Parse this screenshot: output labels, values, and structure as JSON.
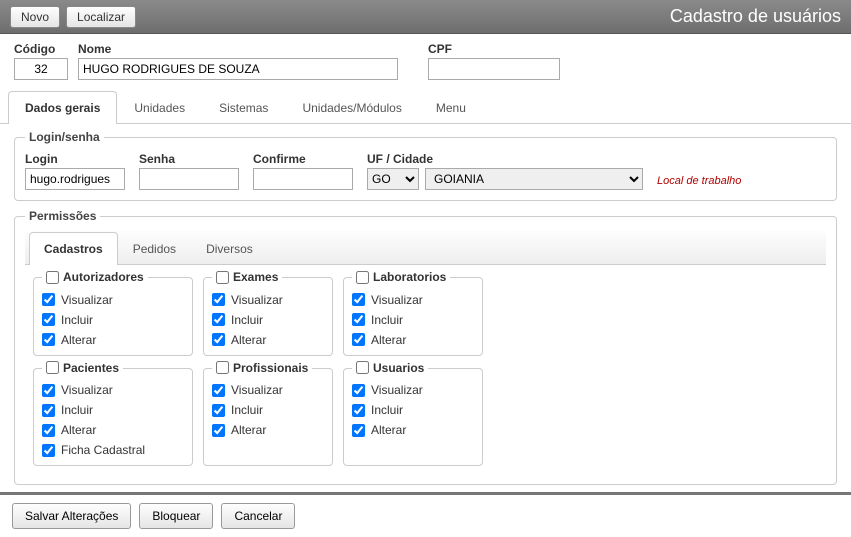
{
  "topbar": {
    "novo": "Novo",
    "localizar": "Localizar",
    "title": "Cadastro de usuários"
  },
  "header": {
    "codigo_label": "Código",
    "codigo_value": "32",
    "nome_label": "Nome",
    "nome_value": "HUGO RODRIGUES DE SOUZA",
    "cpf_label": "CPF",
    "cpf_value": ""
  },
  "main_tabs": {
    "dados": "Dados gerais",
    "unidades": "Unidades",
    "sistemas": "Sistemas",
    "unimod": "Unidades/Módulos",
    "menu": "Menu"
  },
  "login": {
    "legend": "Login/senha",
    "login_label": "Login",
    "login_value": "hugo.rodrigues",
    "senha_label": "Senha",
    "senha_value": "",
    "confirme_label": "Confirme",
    "confirme_value": "",
    "ufcidade_label": "UF / Cidade",
    "uf_value": "GO",
    "cidade_value": "GOIANIA",
    "hint": "Local de trabalho"
  },
  "permissoes": {
    "legend": "Permissões",
    "inner_tabs": {
      "cadastros": "Cadastros",
      "pedidos": "Pedidos",
      "diversos": "Diversos"
    },
    "groups": [
      {
        "name": "Autorizadores",
        "items": [
          {
            "label": "Visualizar",
            "checked": true
          },
          {
            "label": "Incluir",
            "checked": true
          },
          {
            "label": "Alterar",
            "checked": true
          }
        ]
      },
      {
        "name": "Exames",
        "items": [
          {
            "label": "Visualizar",
            "checked": true
          },
          {
            "label": "Incluir",
            "checked": true
          },
          {
            "label": "Alterar",
            "checked": true
          }
        ]
      },
      {
        "name": "Laboratorios",
        "items": [
          {
            "label": "Visualizar",
            "checked": true
          },
          {
            "label": "Incluir",
            "checked": true
          },
          {
            "label": "Alterar",
            "checked": true
          }
        ]
      },
      {
        "name": "Pacientes",
        "items": [
          {
            "label": "Visualizar",
            "checked": true
          },
          {
            "label": "Incluir",
            "checked": true
          },
          {
            "label": "Alterar",
            "checked": true
          },
          {
            "label": "Ficha Cadastral",
            "checked": true
          }
        ]
      },
      {
        "name": "Profissionais",
        "items": [
          {
            "label": "Visualizar",
            "checked": true
          },
          {
            "label": "Incluir",
            "checked": true
          },
          {
            "label": "Alterar",
            "checked": true
          }
        ]
      },
      {
        "name": "Usuarios",
        "items": [
          {
            "label": "Visualizar",
            "checked": true
          },
          {
            "label": "Incluir",
            "checked": true
          },
          {
            "label": "Alterar",
            "checked": true
          }
        ]
      }
    ]
  },
  "bottombar": {
    "salvar": "Salvar Alterações",
    "bloquear": "Bloquear",
    "cancelar": "Cancelar"
  }
}
